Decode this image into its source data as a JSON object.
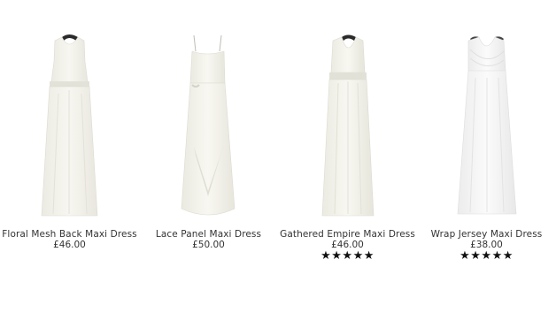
{
  "products": [
    {
      "name": "Floral Mesh Back Maxi Dress",
      "price": "£46.00",
      "rating": null,
      "image_icon": "dress-image"
    },
    {
      "name": "Lace Panel Maxi Dress",
      "price": "£50.00",
      "rating": null,
      "image_icon": "dress-image"
    },
    {
      "name": "Gathered Empire Maxi Dress",
      "price": "£46.00",
      "rating": 5,
      "stars_text": "★★★★★",
      "image_icon": "dress-image"
    },
    {
      "name": "Wrap Jersey Maxi Dress",
      "price": "£38.00",
      "rating": 5,
      "stars_text": "★★★★★",
      "image_icon": "dress-image"
    }
  ]
}
